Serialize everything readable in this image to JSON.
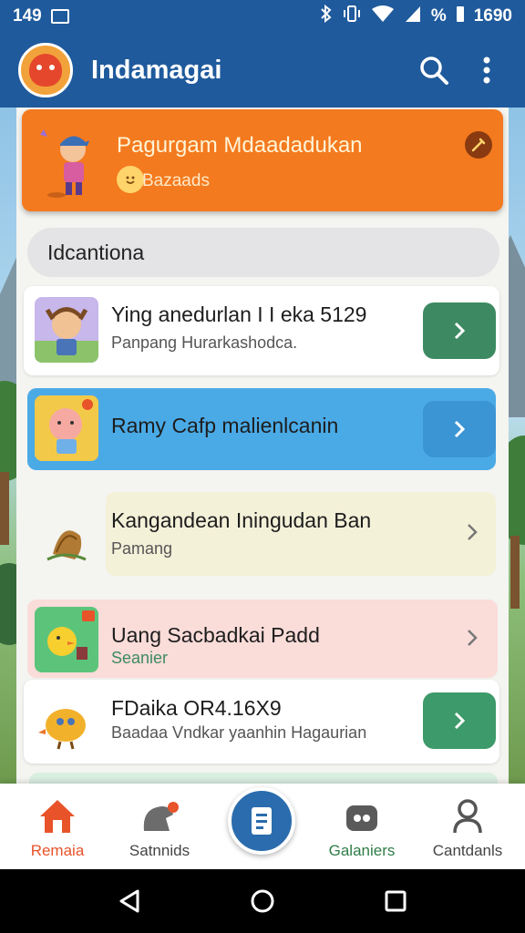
{
  "status_bar": {
    "time_left": "149",
    "time_right": "1690",
    "battery_text": "%"
  },
  "app_bar": {
    "title": "Indamagai",
    "icons": [
      "app-logo-icon",
      "search-icon",
      "more-vert-icon"
    ]
  },
  "banner": {
    "title": "Pagurgam Mdaadadukan",
    "subtitle": "Bazaads"
  },
  "section": {
    "heading": "Idcantiona"
  },
  "cards": [
    {
      "title": "Ying anedurlan I I eka 5129",
      "subtitle": "Panpang Hurarkashodca."
    },
    {
      "title": "Ramy Cafp malienlcanin",
      "subtitle": ""
    },
    {
      "title": "Kangandean Iningudan Ban",
      "subtitle": "Pamang"
    },
    {
      "title": "Uang Sacbadkai Padd",
      "subtitle": "Seanier"
    },
    {
      "title": "FDaika OR4.16X9",
      "subtitle": "Baadaa Vndkar yaanhin Hagaurian"
    }
  ],
  "bottom_nav": {
    "items": [
      {
        "label": "Remaia",
        "icon": "home-icon",
        "color": "#e8532a"
      },
      {
        "label": "Satnnids",
        "icon": "animal-icon",
        "color": "#444444"
      },
      {
        "label": "",
        "icon": "document-icon",
        "color": "#2a6cad"
      },
      {
        "label": "Galaniers",
        "icon": "gamepad-icon",
        "color": "#2f7d48"
      },
      {
        "label": "Cantdanls",
        "icon": "person-icon",
        "color": "#444444"
      }
    ]
  },
  "colors": {
    "primary": "#1f5a9c",
    "accent": "#f47a1f",
    "green": "#3d8a62",
    "blue_card": "#4aaae6"
  }
}
